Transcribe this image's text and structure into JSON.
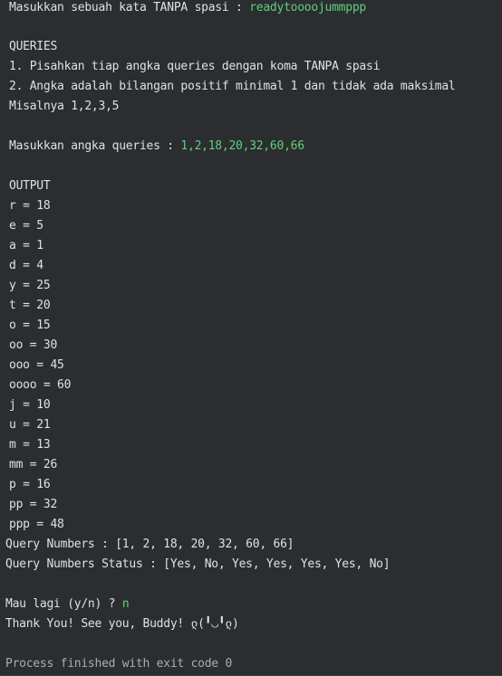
{
  "console": {
    "prompt_word": "Masukkan sebuah kata TANPA spasi : ",
    "word_input": "readytoooojummppp",
    "queries_header": "QUERIES",
    "rule_1": "1. Pisahkan tiap angka queries dengan koma TANPA spasi",
    "rule_2": "2. Angka adalah bilangan positif minimal 1 dan tidak ada maksimal",
    "example": "Misalnya 1,2,3,5",
    "prompt_queries": "Masukkan angka queries : ",
    "queries_input": "1,2,18,20,32,60,66",
    "output_header": "OUTPUT",
    "outputs": [
      "r = 18",
      "e = 5",
      "a = 1",
      "d = 4",
      "y = 25",
      "t = 20",
      "o = 15",
      "oo = 30",
      "ooo = 45",
      "oooo = 60",
      "j = 10",
      "u = 21",
      "m = 13",
      "mm = 26",
      "p = 16",
      "pp = 32",
      "ppp = 48"
    ],
    "query_numbers": "Query Numbers : [1, 2, 18, 20, 32, 60, 66]",
    "query_status": "Query Numbers Status : [Yes, No, Yes, Yes, Yes, Yes, No]",
    "prompt_again": "Mau lagi (y/n) ? ",
    "again_input": "n",
    "farewell": "Thank You! See you, Buddy! ლ(╹◡╹ლ)",
    "exit_message": "Process finished with exit code 0"
  },
  "colors": {
    "background": "#2b2d30",
    "text": "#dfe1e5",
    "user_input": "#5fd07a"
  }
}
